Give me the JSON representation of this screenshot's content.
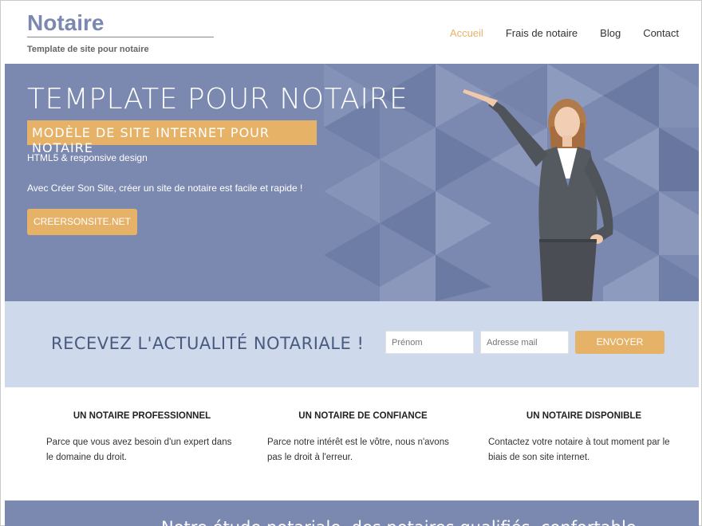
{
  "header": {
    "logo_title": "Notaire",
    "logo_tagline": "Template de site pour notaire",
    "nav": [
      {
        "label": "Accueil",
        "active": true
      },
      {
        "label": "Frais de notaire",
        "active": false
      },
      {
        "label": "Blog",
        "active": false
      },
      {
        "label": "Contact",
        "active": false
      }
    ]
  },
  "hero": {
    "title": "TEMPLATE POUR NOTAIRE",
    "badge": "MODÈLE DE SITE INTERNET POUR NOTAIRE",
    "line1": "HTML5 & responsive design",
    "line2": "Avec Créer Son Site, créer un site de notaire est facile et rapide !",
    "button": "CREERSONSITE.NET"
  },
  "newsletter": {
    "title": "RECEVEZ L'ACTUALITÉ NOTARIALE !",
    "firstname_placeholder": "Prénom",
    "email_placeholder": "Adresse mail",
    "submit": "ENVOYER"
  },
  "features": [
    {
      "title": "UN NOTAIRE PROFESSIONNEL",
      "text": "Parce que vous avez besoin d'un expert dans le domaine du droit."
    },
    {
      "title": "UN NOTAIRE DE CONFIANCE",
      "text": "Parce notre intérêt est le vôtre, nous n'avons pas le droit à l'erreur."
    },
    {
      "title": "UN NOTAIRE DISPONIBLE",
      "text": "Contactez votre notaire à tout moment par le biais de son site internet."
    }
  ],
  "bottom_band": {
    "text": "Notre étude notariale, des notaires qualifiés, confortable"
  },
  "colors": {
    "brand_blue": "#7b89b0",
    "accent_gold": "#e6b267",
    "light_blue": "#cfd9ec"
  }
}
